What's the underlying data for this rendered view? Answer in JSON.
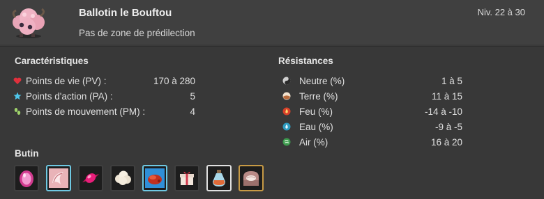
{
  "monster": {
    "name": "Ballotin le Bouftou",
    "zone": "Pas de zone de prédilection",
    "level": "Niv. 22 à 30"
  },
  "characteristics": {
    "title": "Caractéristiques",
    "items": [
      {
        "label": "Points de vie (PV) :",
        "value": "170 à 280",
        "icon": "heart-icon"
      },
      {
        "label": "Points d'action (PA) :",
        "value": "5",
        "icon": "star-icon"
      },
      {
        "label": "Points de mouvement (PM) :",
        "value": "4",
        "icon": "footstep-icon"
      }
    ]
  },
  "resistances": {
    "title": "Résistances",
    "items": [
      {
        "label": "Neutre (%)",
        "value": "1 à 5",
        "icon": "neutral-element-icon"
      },
      {
        "label": "Terre (%)",
        "value": "11 à 15",
        "icon": "earth-element-icon"
      },
      {
        "label": "Feu (%)",
        "value": "-14 à -10",
        "icon": "fire-element-icon"
      },
      {
        "label": "Eau (%)",
        "value": "-9 à -5",
        "icon": "water-element-icon"
      },
      {
        "label": "Air (%)",
        "value": "16 à 20",
        "icon": "air-element-icon"
      }
    ]
  },
  "loot": {
    "title": "Butin",
    "items": [
      {
        "name": "pink-egg-icon",
        "rarity": "common"
      },
      {
        "name": "wool-skin-icon",
        "rarity": "rare"
      },
      {
        "name": "pink-candy-icon",
        "rarity": "common"
      },
      {
        "name": "white-wool-icon",
        "rarity": "common"
      },
      {
        "name": "red-meat-icon",
        "rarity": "rare"
      },
      {
        "name": "gift-box-icon",
        "rarity": "common"
      },
      {
        "name": "potion-bottle-icon",
        "rarity": "uncommon"
      },
      {
        "name": "treasure-chest-icon",
        "rarity": "epic"
      }
    ]
  },
  "colors": {
    "background": "#383838",
    "header": "#404040",
    "rare_border": "#6ec8e2",
    "epic_border": "#c79a45"
  }
}
